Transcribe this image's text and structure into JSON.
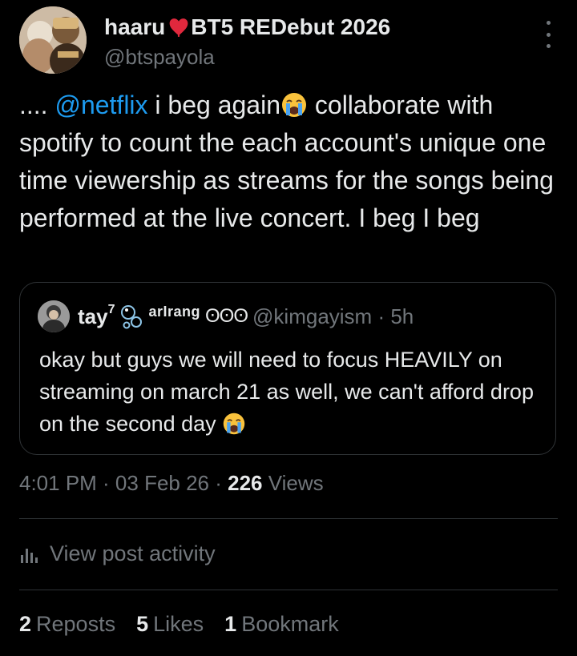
{
  "author": {
    "name_prefix": "haaru",
    "name_suffix": "BT5 REDebut 2026",
    "handle": "@btspayola"
  },
  "post": {
    "text_pre": ".... ",
    "mention": "@netflix",
    "text_mid": " i beg again",
    "text_post": " collaborate with spotify to count the each account's unique one time viewership as streams for the songs being performed at the live concert. I beg I beg"
  },
  "quote": {
    "name": "tay",
    "name_sup": "7",
    "badge_text": "arIrang",
    "circles": "ʘʘʘ",
    "handle": "@kimgayism · 5h",
    "text": "okay but guys we will need to focus HEAVILY on streaming on march 21 as well, we can't afford drop on the second day "
  },
  "meta": {
    "time": "4:01 PM · 03 Feb 26 · ",
    "views_count": "226",
    "views_label": " Views"
  },
  "activity": {
    "label": "View post activity"
  },
  "stats": {
    "reposts_count": "2",
    "reposts_label": "Reposts",
    "likes_count": "5",
    "likes_label": "Likes",
    "bookmarks_count": "1",
    "bookmarks_label": "Bookmark"
  },
  "icons": {
    "menu": "more-vertical-icon",
    "heart": "red-heart-icon",
    "emoji": "loudly-crying-face-icon",
    "activity": "bar-chart-icon"
  },
  "colors": {
    "background": "#000000",
    "text": "#e7e9ea",
    "secondary": "#71767b",
    "link": "#1d9bf0",
    "border": "#2f3336"
  }
}
